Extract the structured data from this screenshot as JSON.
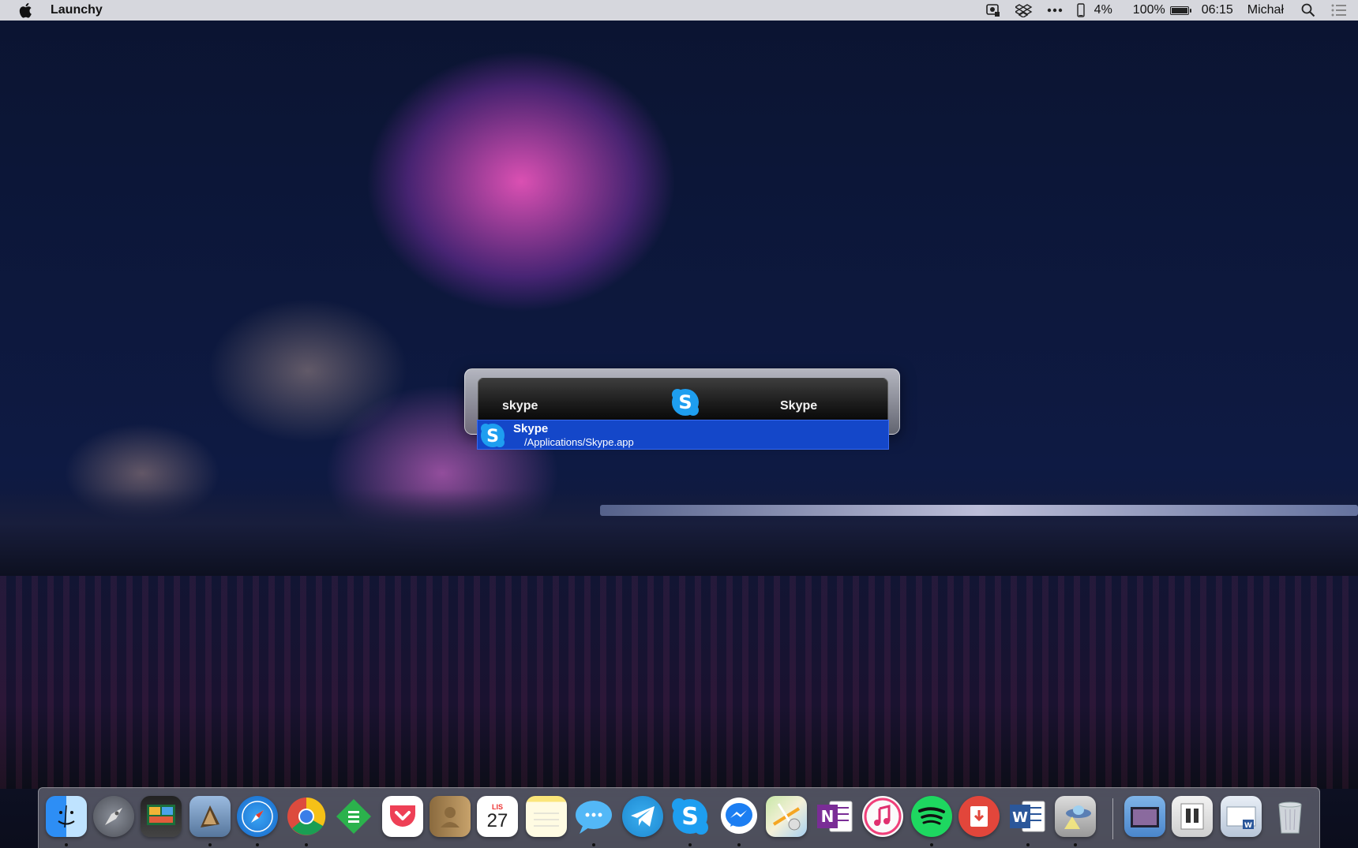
{
  "menubar": {
    "app_name": "Launchy",
    "battery_small": "4%",
    "battery_main": "100%",
    "time": "06:15",
    "user": "Michał"
  },
  "launchy": {
    "query": "skype",
    "match_name": "Skype",
    "results": [
      {
        "name": "Skype",
        "path": "/Applications/Skype.app",
        "icon": "skype-icon"
      }
    ]
  },
  "calendar": {
    "month": "LIS",
    "day": "27"
  },
  "dock": [
    {
      "name": "finder-icon",
      "running": true
    },
    {
      "name": "launchpad-icon",
      "running": false
    },
    {
      "name": "photo-slideshow-icon",
      "running": false
    },
    {
      "name": "mail-icon",
      "running": true
    },
    {
      "name": "safari-icon",
      "running": true
    },
    {
      "name": "chrome-icon",
      "running": true
    },
    {
      "name": "feedly-icon",
      "running": false
    },
    {
      "name": "pocket-icon",
      "running": false
    },
    {
      "name": "contacts-icon",
      "running": false
    },
    {
      "name": "calendar-icon",
      "running": false
    },
    {
      "name": "notes-icon",
      "running": false
    },
    {
      "name": "messages-icon",
      "running": true
    },
    {
      "name": "telegram-icon",
      "running": false
    },
    {
      "name": "skype-icon",
      "running": true
    },
    {
      "name": "messenger-icon",
      "running": true
    },
    {
      "name": "maps-icon",
      "running": false
    },
    {
      "name": "onenote-icon",
      "running": false
    },
    {
      "name": "itunes-icon",
      "running": false
    },
    {
      "name": "spotify-icon",
      "running": true
    },
    {
      "name": "pdf-icon",
      "running": false
    },
    {
      "name": "word-icon",
      "running": true
    },
    {
      "name": "ufo-app-icon",
      "running": true
    }
  ]
}
